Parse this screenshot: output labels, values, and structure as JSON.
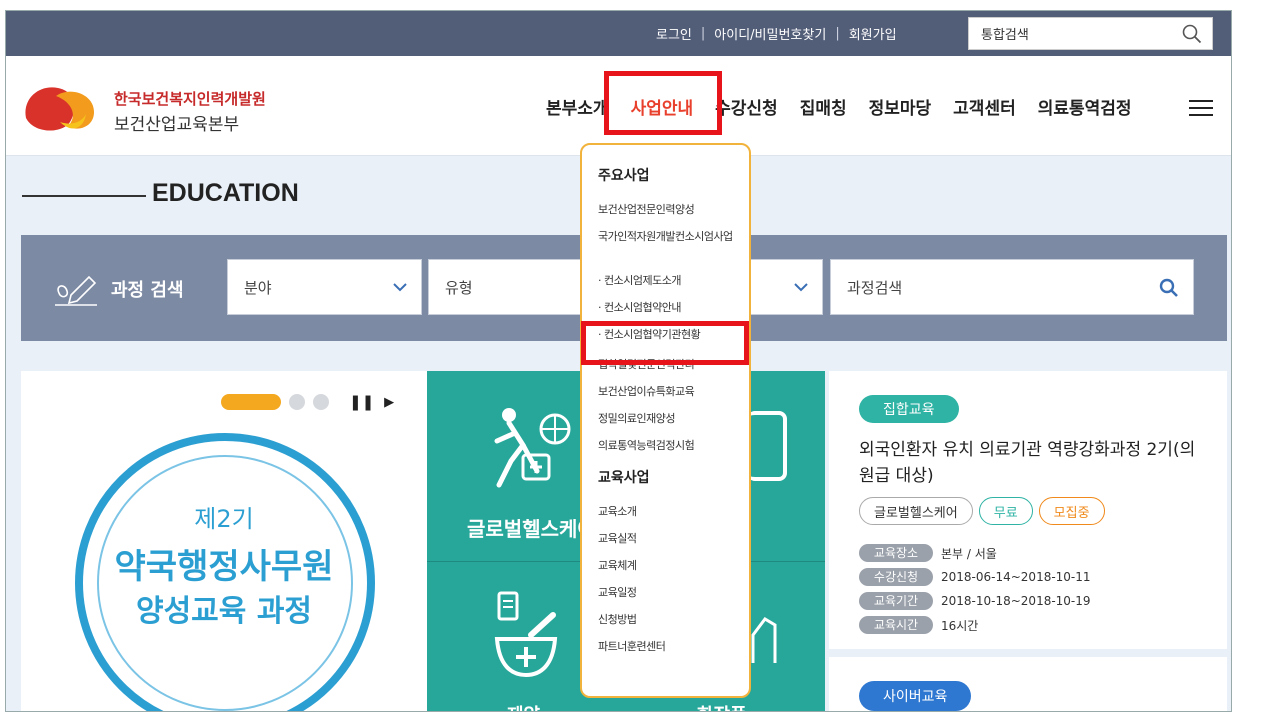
{
  "topbar": {
    "links": [
      "로그인",
      "아이디/비밀번호찾기",
      "회원가입"
    ],
    "search_placeholder": "통합검색"
  },
  "header": {
    "org_name": "한국보건복지인력개발원",
    "org_sub": "보건산업교육본부",
    "menu": [
      "본부소개",
      "사업안내",
      "수강신청",
      "집매칭",
      "정보마당",
      "고객센터",
      "의료통역검정"
    ]
  },
  "education": {
    "title": "EDUCATION",
    "search_label": "과정 검색",
    "select1": "분야",
    "select2": "유형",
    "keyword_placeholder": "과정검색"
  },
  "dropdown": {
    "section1": "주요사업",
    "items1": [
      "보건산업전문인력양성",
      "국가인적자원개발컨소시엄사업",
      "· 컨소시엄제도소개",
      "· 컨소시엄협약안내",
      "· 컨소시엄협약기관현황",
      "접착일몇전문인력관리",
      "보건산업이슈특화교육",
      "정밀의료인재양성",
      "의료통역능력검정시험"
    ],
    "section2": "교육사업",
    "items2": [
      "교육소개",
      "교육실적",
      "교육체계",
      "교육일정",
      "신청방법",
      "파트너훈련센터"
    ]
  },
  "slider": {
    "line1": "제2기",
    "line2": "약국행정사무원",
    "line3": "양성교육 과정"
  },
  "categories": {
    "item1": "글로벌헬스케어",
    "item2": "제약",
    "item3": "화장품"
  },
  "course": {
    "tag": "집합교육",
    "title": "외국인환자 유치 의료기관 역량강화과정 2기(의원급 대상)",
    "chips": [
      "글로벌헬스케어",
      "무료",
      "모집중"
    ],
    "info": [
      {
        "k": "교육장소",
        "v": "본부 / 서울"
      },
      {
        "k": "수강신청",
        "v": "2018-06-14~2018-10-11"
      },
      {
        "k": "교육기간",
        "v": "2018-10-18~2018-10-19"
      },
      {
        "k": "교육시간",
        "v": "16시간"
      }
    ],
    "tag2": "사이버교육"
  },
  "colors": {
    "topbar": "#525d78",
    "accent_red": "#e8402c",
    "highlight_box": "#e8141b",
    "teal": "#27a79a",
    "blue": "#2c9fd2"
  }
}
